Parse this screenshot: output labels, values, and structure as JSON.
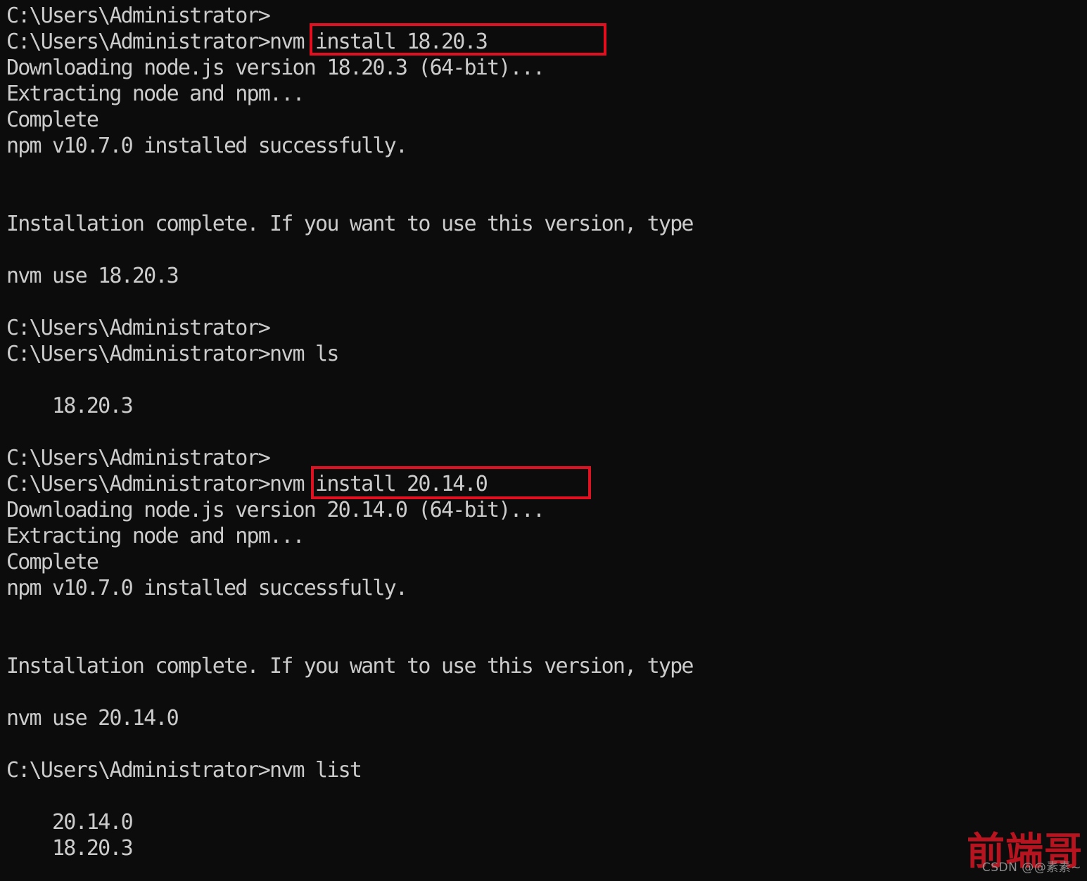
{
  "terminal": {
    "background_color": "#0c0c0c",
    "text_color": "#cccccc",
    "prompt": "C:\\Users\\Administrator>",
    "lines": [
      "C:\\Users\\Administrator>",
      "C:\\Users\\Administrator>nvm install 18.20.3",
      "Downloading node.js version 18.20.3 (64-bit)...",
      "Extracting node and npm...",
      "Complete",
      "npm v10.7.0 installed successfully.",
      "",
      "",
      "Installation complete. If you want to use this version, type",
      "",
      "nvm use 18.20.3",
      "",
      "C:\\Users\\Administrator>",
      "C:\\Users\\Administrator>nvm ls",
      "",
      "    18.20.3",
      "",
      "C:\\Users\\Administrator>",
      "C:\\Users\\Administrator>nvm install 20.14.0",
      "Downloading node.js version 20.14.0 (64-bit)...",
      "Extracting node and npm...",
      "Complete",
      "npm v10.7.0 installed successfully.",
      "",
      "",
      "Installation complete. If you want to use this version, type",
      "",
      "nvm use 20.14.0",
      "",
      "C:\\Users\\Administrator>nvm list",
      "",
      "    20.14.0",
      "    18.20.3"
    ],
    "text": "C:\\Users\\Administrator>\nC:\\Users\\Administrator>nvm install 18.20.3\nDownloading node.js version 18.20.3 (64-bit)...\nExtracting node and npm...\nComplete\nnpm v10.7.0 installed successfully.\n\n\nInstallation complete. If you want to use this version, type\n\nnvm use 18.20.3\n\nC:\\Users\\Administrator>\nC:\\Users\\Administrator>nvm ls\n\n    18.20.3\n\nC:\\Users\\Administrator>\nC:\\Users\\Administrator>nvm install 20.14.0\nDownloading node.js version 20.14.0 (64-bit)...\nExtracting node and npm...\nComplete\nnpm v10.7.0 installed successfully.\n\n\nInstallation complete. If you want to use this version, type\n\nnvm use 20.14.0\n\nC:\\Users\\Administrator>nvm list\n\n    20.14.0\n    18.20.3"
  },
  "commands": [
    {
      "name": "install-18",
      "text": "nvm install 18.20.3",
      "highlighted": true,
      "highlight_color": "#e01020"
    },
    {
      "name": "list-short",
      "text": "nvm ls",
      "highlighted": false
    },
    {
      "name": "install-20",
      "text": "nvm install 20.14.0",
      "highlighted": true,
      "highlight_color": "#e01020"
    },
    {
      "name": "list-full",
      "text": "nvm list",
      "highlighted": false
    }
  ],
  "installed_versions": [
    "20.14.0",
    "18.20.3"
  ],
  "npm_version": "v10.7.0",
  "watermark": {
    "main_text": "前端哥",
    "sub_text": "CSDN @@素素~",
    "main_color": "#b81420",
    "sub_color": "#8d8d8d"
  }
}
